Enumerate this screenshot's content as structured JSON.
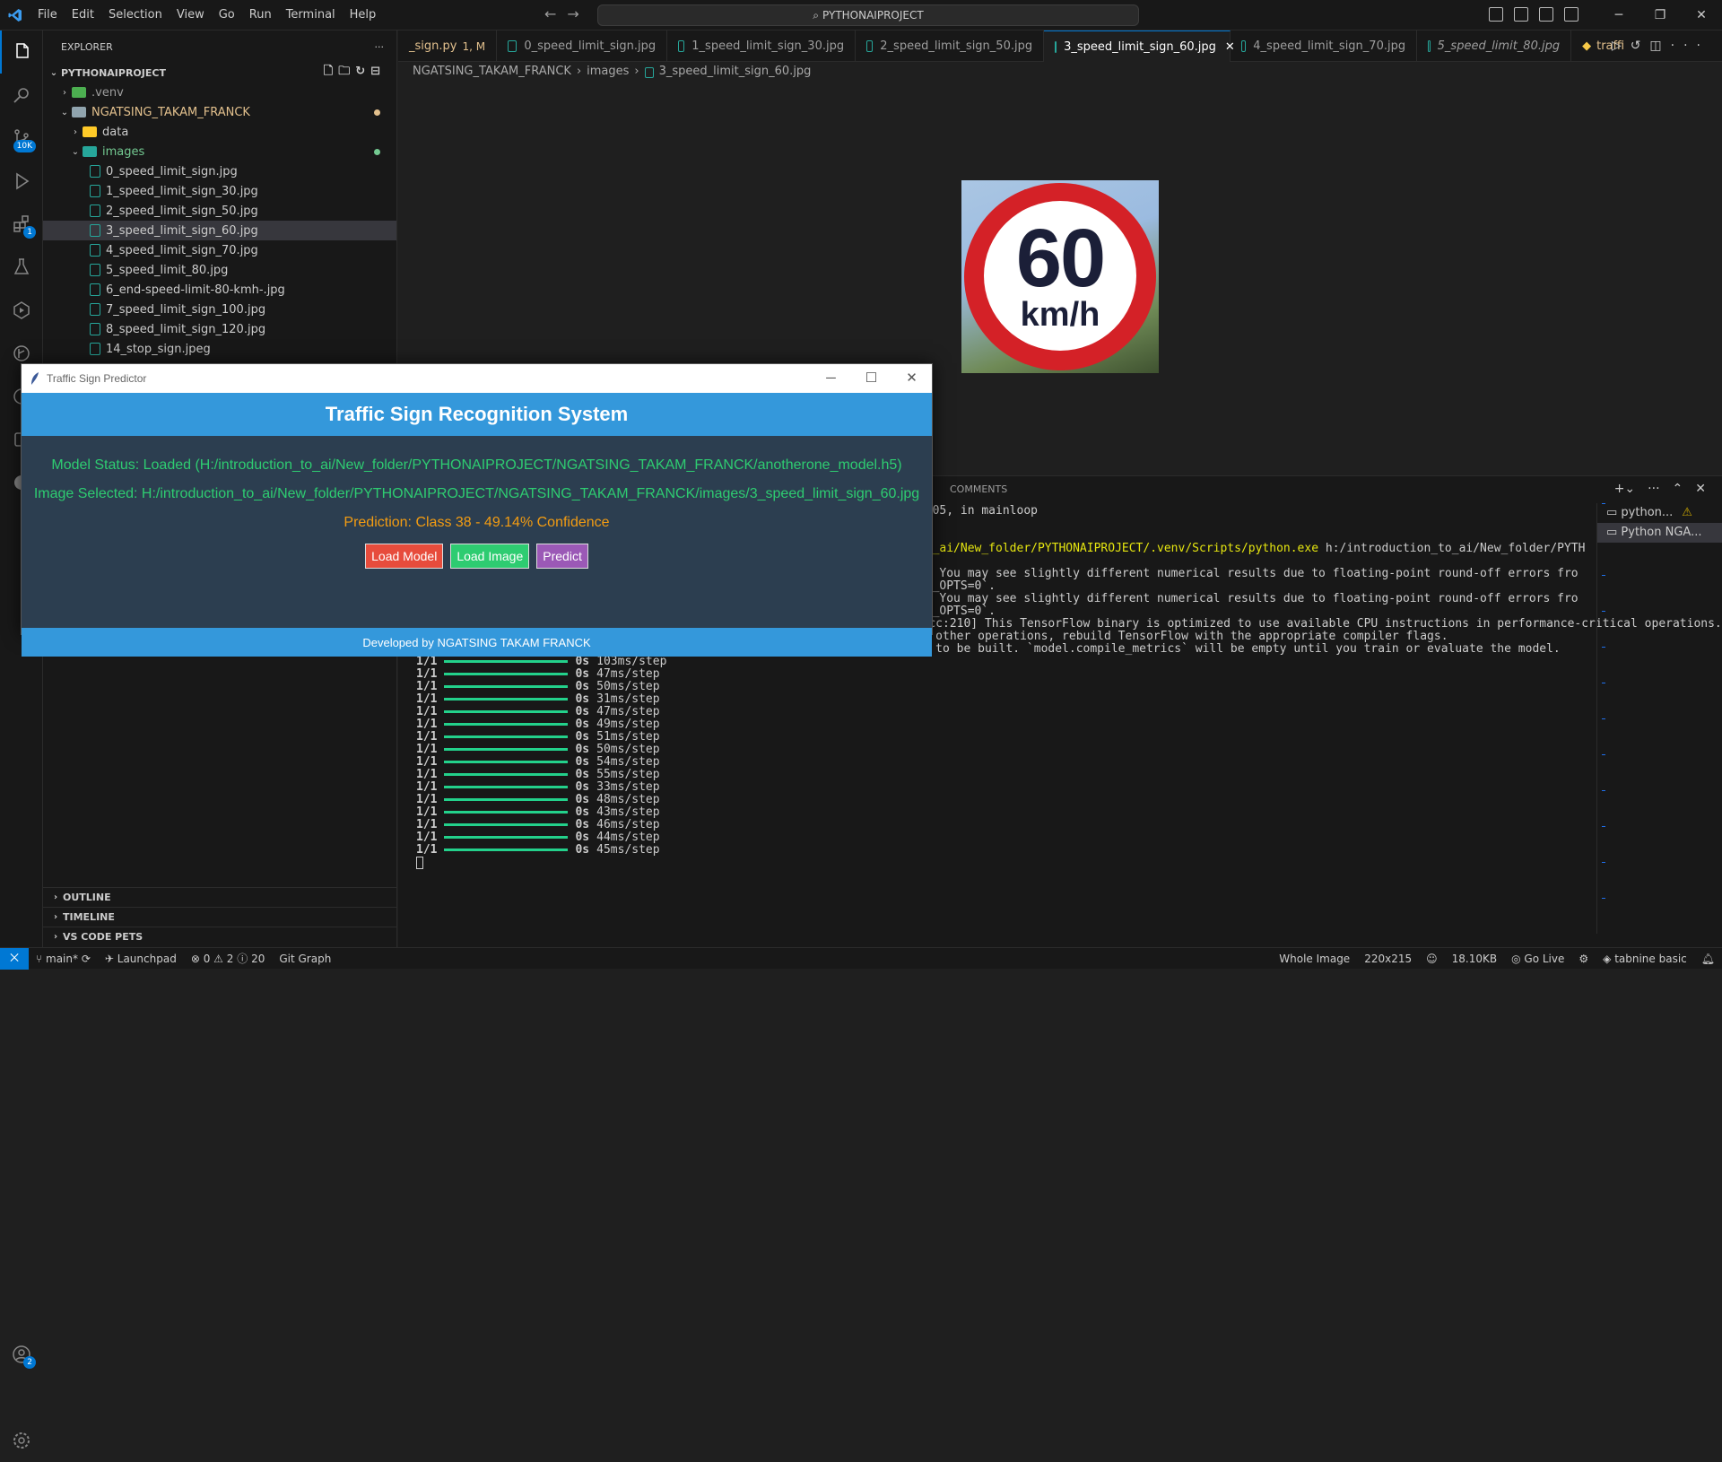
{
  "titlebar": {
    "menu": [
      "File",
      "Edit",
      "Selection",
      "View",
      "Go",
      "Run",
      "Terminal",
      "Help"
    ],
    "search": "PYTHONAIPROJECT"
  },
  "activity": {
    "source_control_badge": "10K",
    "extensions_badge": "1",
    "accounts_badge": "2"
  },
  "sidebar": {
    "title": "EXPLORER",
    "project": "PYTHONAIPROJECT",
    "venv": ".venv",
    "folder": "NGATSING_TAKAM_FRANCK",
    "data_folder": "data",
    "images_folder": "images",
    "files": [
      "0_speed_limit_sign.jpg",
      "1_speed_limit_sign_30.jpg",
      "2_speed_limit_sign_50.jpg",
      "3_speed_limit_sign_60.jpg",
      "4_speed_limit_sign_70.jpg",
      "5_speed_limit_80.jpg",
      "6_end-speed-limit-80-kmh-.jpg",
      "7_speed_limit_sign_100.jpg",
      "8_speed_limit_sign_120.jpg",
      "14_stop_sign.jpeg"
    ],
    "bottom": [
      "OUTLINE",
      "TIMELINE",
      "VS CODE PETS"
    ]
  },
  "tabs": [
    {
      "label": "_sign.py",
      "suffix": "1, M"
    },
    {
      "label": "0_speed_limit_sign.jpg"
    },
    {
      "label": "1_speed_limit_sign_30.jpg"
    },
    {
      "label": "2_speed_limit_sign_50.jpg"
    },
    {
      "label": "3_speed_limit_sign_60.jpg"
    },
    {
      "label": "4_speed_limit_sign_70.jpg"
    },
    {
      "label": "5_speed_limit_80.jpg"
    },
    {
      "label": "traffi"
    }
  ],
  "breadcrumb": [
    "NGATSING_TAKAM_FRANCK",
    "images",
    "3_speed_limit_sign_60.jpg"
  ],
  "sign": {
    "number": "60",
    "unit": "km/h"
  },
  "panel": {
    "tab": "COMMENTS",
    "terminals": [
      "python...",
      "Python NGA..."
    ],
    "lines": [
      "_.py\", line 1505, in mainloop",
      "",
      "",
      "ntroduction_to_ai/New_folder/PYTHONAIPROJECT/.venv/Scripts/python.exe",
      " h:/introduction_to_ai/New_folder/PYTH",
      "",
      "ations are on. You may see slightly different numerical results due to floating-point round-off errors fro",
      "_ENABLE_ONEDNN_OPTS=0`.",
      "ations are on. You may see slightly different numerical results due to floating-point round-off errors fro",
      "_ENABLE_ONEDNN_OPTS=0`.",
      "2025-03-30 19:31:05.719651: I tensorflow/core/platform/cpu_feature_guard.cc:210] This TensorFlow binary is optimized to use available CPU instructions in performance-critical operations.",
      "To enable the following instructions: SSE3 SSE4.1 SSE4.2 AVX AVX2 FMA, in other operations, rebuild TensorFlow with the appropriate compiler flags.",
      "WARNING:absl:Compiled the loaded model, but the compiled metrics have yet to be built. `model.compile_metrics` will be empty until you train or evaluate the model."
    ],
    "steps": [
      "103ms/step",
      "47ms/step",
      "50ms/step",
      "31ms/step",
      "47ms/step",
      "49ms/step",
      "51ms/step",
      "50ms/step",
      "54ms/step",
      "55ms/step",
      "33ms/step",
      "48ms/step",
      "43ms/step",
      "46ms/step",
      "44ms/step",
      "45ms/step"
    ],
    "step_prefix": "1/1",
    "step_time": "0s"
  },
  "statusbar": {
    "branch": "main*",
    "launchpad": "Launchpad",
    "problems": "0",
    "warnings": "2",
    "infos": "20",
    "gitgraph": "Git Graph",
    "whole_image": "Whole Image",
    "dims": "220x215",
    "size": "18.10KB",
    "golive": "Go Live",
    "tabnine": "tabnine basic"
  },
  "tk": {
    "window_title": "Traffic Sign Predictor",
    "header": "Traffic Sign Recognition System",
    "model_status": "Model Status: Loaded (H:/introduction_to_ai/New_folder/PYTHONAIPROJECT/NGATSING_TAKAM_FRANCK/anotherone_model.h5)",
    "image_selected": "Image Selected: H:/introduction_to_ai/New_folder/PYTHONAIPROJECT/NGATSING_TAKAM_FRANCK/images/3_speed_limit_sign_60.jpg",
    "prediction": "Prediction: Class 38 - 49.14% Confidence",
    "btn_load_model": "Load Model",
    "btn_load_image": "Load Image",
    "btn_predict": "Predict",
    "footer": "Developed by NGATSING TAKAM FRANCK",
    "colors": {
      "header": "#3498db",
      "bg": "#2c3e50",
      "status": "#2ecc71",
      "prediction": "#f39c12",
      "load_model": "#e74c3c",
      "load_image": "#2ecc71",
      "predict": "#9b59b6"
    }
  }
}
